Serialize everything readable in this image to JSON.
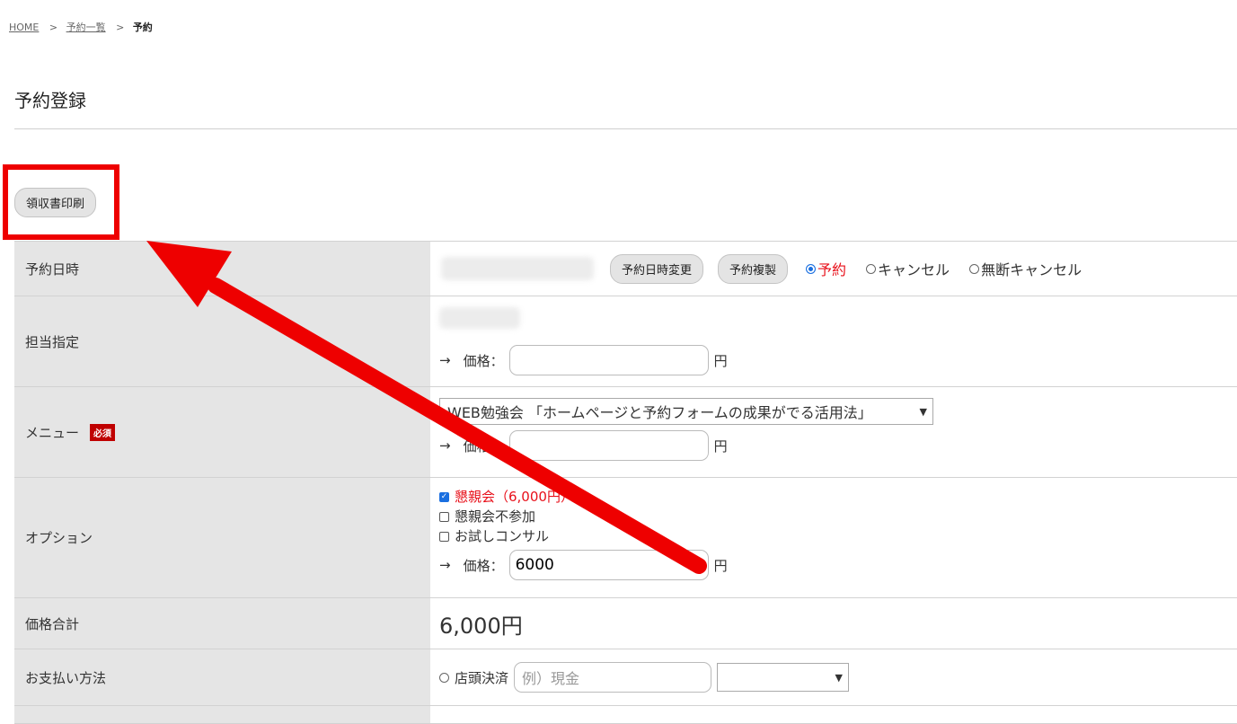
{
  "breadcrumb": {
    "home": "HOME",
    "sep": ">",
    "list": "予約一覧",
    "current": "予約"
  },
  "page": {
    "title": "予約登録"
  },
  "receipt_button": "領収書印刷",
  "rows": {
    "datetime": {
      "label": "予約日時",
      "change_button": "予約日時変更",
      "copy_button": "予約複製",
      "status_options": [
        "予約",
        "キャンセル",
        "無断キャンセル"
      ],
      "status_selected": "予約"
    },
    "staff": {
      "label": "担当指定",
      "arrow": "→",
      "price_label": "価格：",
      "price_value": "",
      "yen": "円"
    },
    "menu": {
      "label": "メニュー",
      "required": "必須",
      "selected": "WEB勉強会 「ホームページと予約フォームの成果がでる活用法」",
      "arrow": "→",
      "price_label": "価格：",
      "price_value": "",
      "yen": "円"
    },
    "options": {
      "label": "オプション",
      "items": [
        {
          "label": "懇親会（6,000円）",
          "checked": true
        },
        {
          "label": "懇親会不参加",
          "checked": false
        },
        {
          "label": "お試しコンサル",
          "checked": false
        }
      ],
      "arrow": "→",
      "price_label": "価格：",
      "price_value": "6000",
      "yen": "円"
    },
    "total": {
      "label": "価格合計",
      "value": "6,000円"
    },
    "payment": {
      "label": "お支払い方法",
      "option": "店頭決済",
      "placeholder": "例）現金",
      "select_value": ""
    }
  },
  "colors": {
    "accent_red": "#e8101a",
    "highlight": "#ee0000",
    "label_bg": "#e5e5e5",
    "required_bg": "#c00000"
  }
}
